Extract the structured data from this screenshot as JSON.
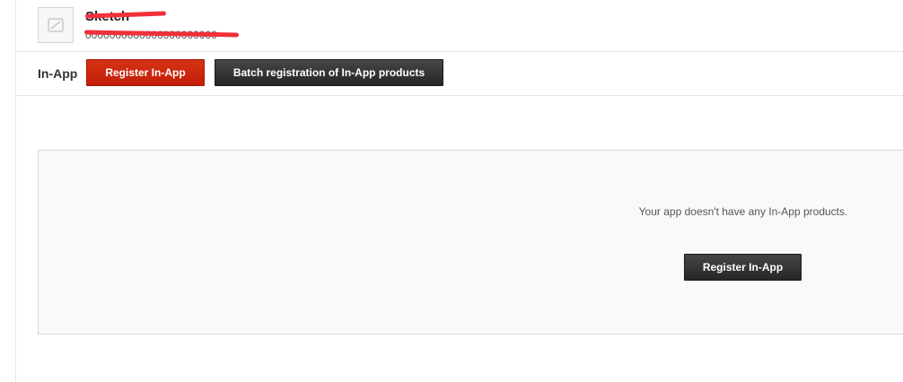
{
  "app": {
    "name": "Sketch",
    "id": "0000000000000000000000"
  },
  "toolbar": {
    "section_label": "In-App",
    "register_label": "Register In-App",
    "batch_label": "Batch registration of In-App products"
  },
  "empty_state": {
    "message": "Your app doesn't have any In-App products.",
    "register_label": "Register In-App"
  },
  "colors": {
    "primary_red": "#c8230b",
    "dark_button": "#333333",
    "panel_bg": "#f9f9f9"
  },
  "icons": {
    "app_thumb": "image-placeholder-icon"
  }
}
